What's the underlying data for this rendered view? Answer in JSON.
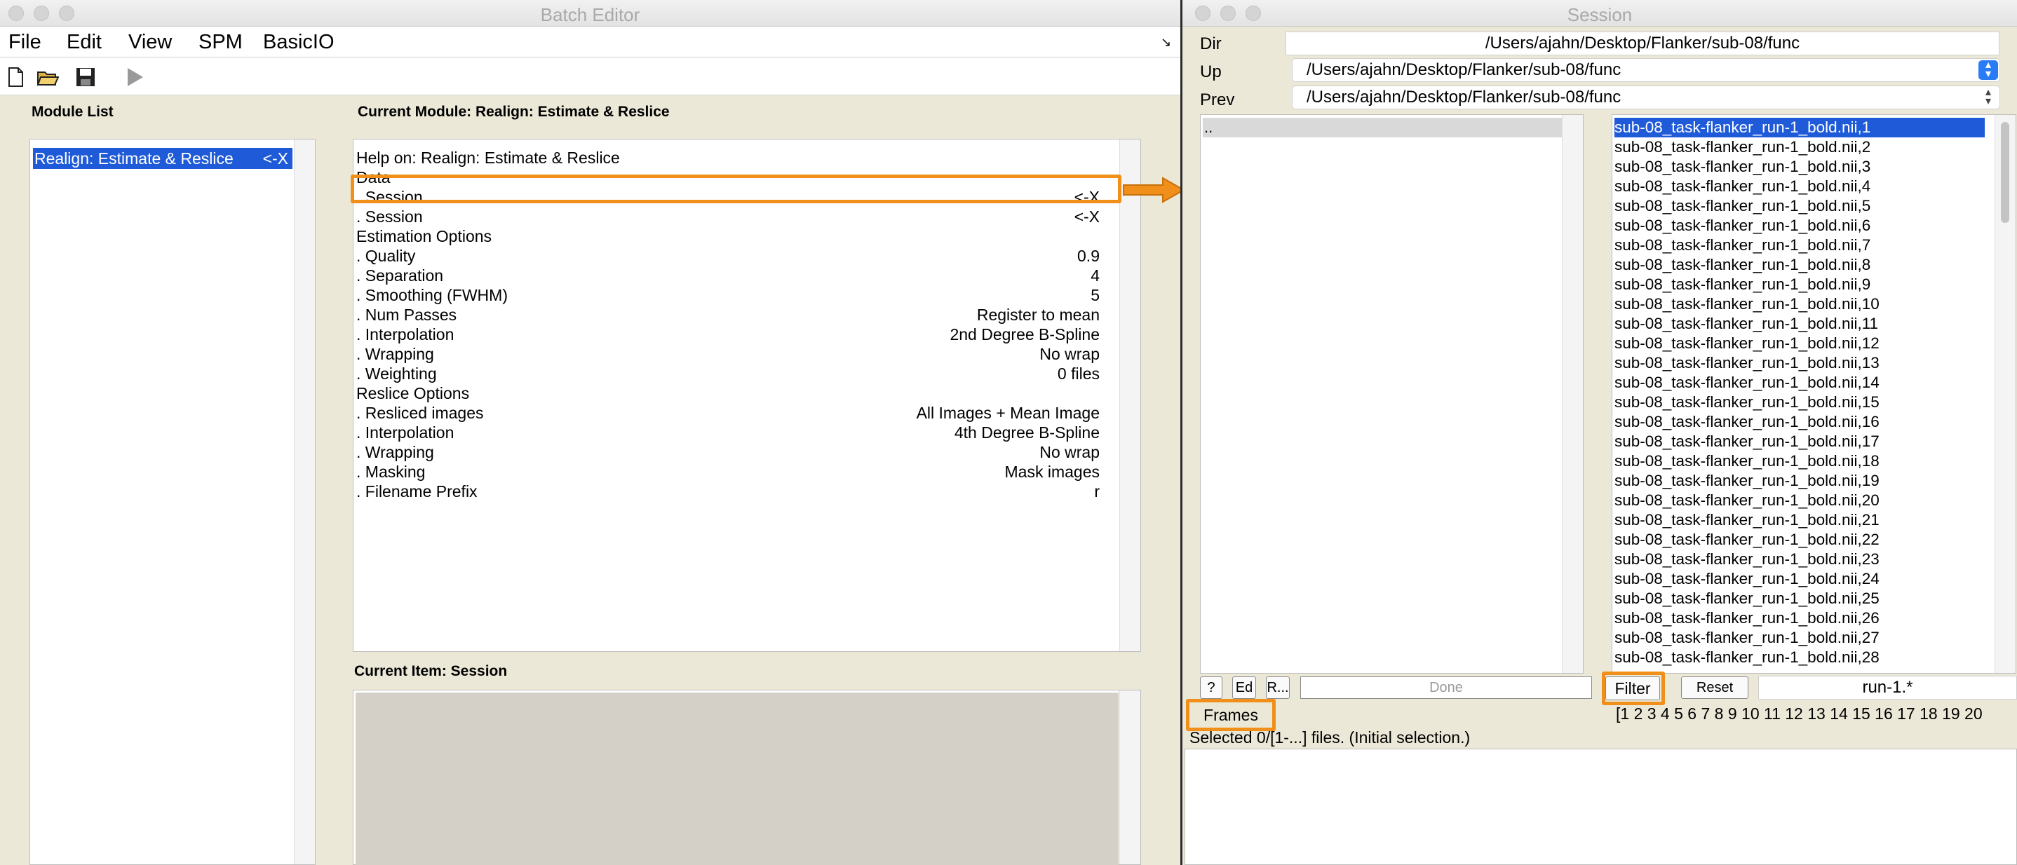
{
  "batch_editor": {
    "title": "Batch Editor",
    "menu": [
      "File",
      "Edit",
      "View",
      "SPM",
      "BasicIO"
    ],
    "module_list_label": "Module List",
    "module_list": [
      {
        "name": "Realign: Estimate & Reslice",
        "marker": "<-X"
      }
    ],
    "current_module_label": "Current Module: Realign: Estimate & Reslice",
    "items": [
      {
        "label": "Help on: Realign: Estimate & Reslice",
        "value": ""
      },
      {
        "label": "Data",
        "value": ""
      },
      {
        "label": ". Session",
        "value": "<-X"
      },
      {
        "label": ". Session",
        "value": "<-X"
      },
      {
        "label": "Estimation Options",
        "value": ""
      },
      {
        "label": ". Quality",
        "value": "0.9"
      },
      {
        "label": ". Separation",
        "value": "4"
      },
      {
        "label": ". Smoothing (FWHM)",
        "value": "5"
      },
      {
        "label": ". Num Passes",
        "value": "Register to mean"
      },
      {
        "label": ". Interpolation",
        "value": "2nd Degree B-Spline"
      },
      {
        "label": ". Wrapping",
        "value": "No wrap"
      },
      {
        "label": ". Weighting",
        "value": "0 files"
      },
      {
        "label": "Reslice Options",
        "value": ""
      },
      {
        "label": ". Resliced images",
        "value": "All Images + Mean Image"
      },
      {
        "label": ". Interpolation",
        "value": "4th Degree B-Spline"
      },
      {
        "label": ". Wrapping",
        "value": "No wrap"
      },
      {
        "label": ". Masking",
        "value": "Mask images"
      },
      {
        "label": ". Filename Prefix",
        "value": "r"
      }
    ],
    "current_item_label": "Current Item: Session"
  },
  "session": {
    "title": "Session",
    "dir_label": "Dir",
    "dir_value": "/Users/ajahn/Desktop/Flanker/sub-08/func",
    "up_label": "Up",
    "up_value": "/Users/ajahn/Desktop/Flanker/sub-08/func",
    "prev_label": "Prev",
    "prev_value": "/Users/ajahn/Desktop/Flanker/sub-08/func",
    "dirs": [
      ".."
    ],
    "files": [
      "sub-08_task-flanker_run-1_bold.nii,1",
      "sub-08_task-flanker_run-1_bold.nii,2",
      "sub-08_task-flanker_run-1_bold.nii,3",
      "sub-08_task-flanker_run-1_bold.nii,4",
      "sub-08_task-flanker_run-1_bold.nii,5",
      "sub-08_task-flanker_run-1_bold.nii,6",
      "sub-08_task-flanker_run-1_bold.nii,7",
      "sub-08_task-flanker_run-1_bold.nii,8",
      "sub-08_task-flanker_run-1_bold.nii,9",
      "sub-08_task-flanker_run-1_bold.nii,10",
      "sub-08_task-flanker_run-1_bold.nii,11",
      "sub-08_task-flanker_run-1_bold.nii,12",
      "sub-08_task-flanker_run-1_bold.nii,13",
      "sub-08_task-flanker_run-1_bold.nii,14",
      "sub-08_task-flanker_run-1_bold.nii,15",
      "sub-08_task-flanker_run-1_bold.nii,16",
      "sub-08_task-flanker_run-1_bold.nii,17",
      "sub-08_task-flanker_run-1_bold.nii,18",
      "sub-08_task-flanker_run-1_bold.nii,19",
      "sub-08_task-flanker_run-1_bold.nii,20",
      "sub-08_task-flanker_run-1_bold.nii,21",
      "sub-08_task-flanker_run-1_bold.nii,22",
      "sub-08_task-flanker_run-1_bold.nii,23",
      "sub-08_task-flanker_run-1_bold.nii,24",
      "sub-08_task-flanker_run-1_bold.nii,25",
      "sub-08_task-flanker_run-1_bold.nii,26",
      "sub-08_task-flanker_run-1_bold.nii,27",
      "sub-08_task-flanker_run-1_bold.nii,28"
    ],
    "btn_help": "?",
    "btn_ed": "Ed",
    "btn_r": "R...",
    "btn_done": "Done",
    "btn_filter": "Filter",
    "btn_reset": "Reset",
    "filter_value": "run-1.*",
    "btn_frames": "Frames",
    "frames_value": "[1 2 3 4 5 6 7 8 9 10 11 12 13 14 15 16 17 18 19 20",
    "status": "Selected 0/[1-...] files. (Initial selection.)"
  },
  "colors": {
    "selection": "#1f5bd8",
    "highlight": "#f0901b",
    "window_bg": "#ece8d8"
  }
}
